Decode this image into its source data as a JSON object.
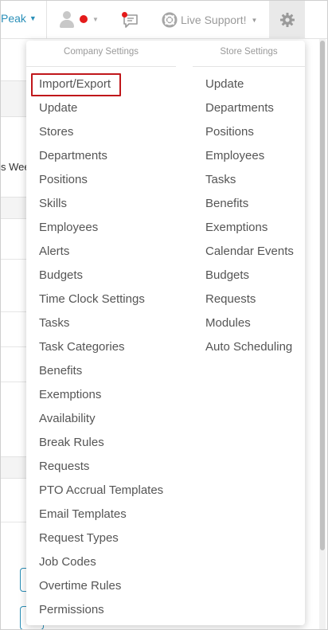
{
  "header": {
    "brand": "Peak",
    "support_label": "Live Support!"
  },
  "background": {
    "fragment_1": "s Wee"
  },
  "menu": {
    "company": {
      "title": "Company Settings",
      "items": [
        "Import/Export",
        "Update",
        "Stores",
        "Departments",
        "Positions",
        "Skills",
        "Employees",
        "Alerts",
        "Budgets",
        "Time Clock Settings",
        "Tasks",
        "Task Categories",
        "Benefits",
        "Exemptions",
        "Availability",
        "Break Rules",
        "Requests",
        "PTO Accrual Templates",
        "Email Templates",
        "Request Types",
        "Job Codes",
        "Overtime Rules",
        "Permissions"
      ],
      "highlighted_item": "Import/Export"
    },
    "store": {
      "title": "Store Settings",
      "items": [
        "Update",
        "Departments",
        "Positions",
        "Employees",
        "Tasks",
        "Benefits",
        "Exemptions",
        "Calendar Events",
        "Budgets",
        "Requests",
        "Modules",
        "Auto Scheduling"
      ]
    }
  },
  "colors": {
    "brand": "#2a8fb8",
    "status_dot": "#e41b1b",
    "highlight_border": "#c0171b"
  },
  "icons": {
    "user": "user-icon",
    "status": "status-dot-icon",
    "chat": "chat-icon",
    "support": "lifebuoy-icon",
    "settings": "gear-icon"
  }
}
